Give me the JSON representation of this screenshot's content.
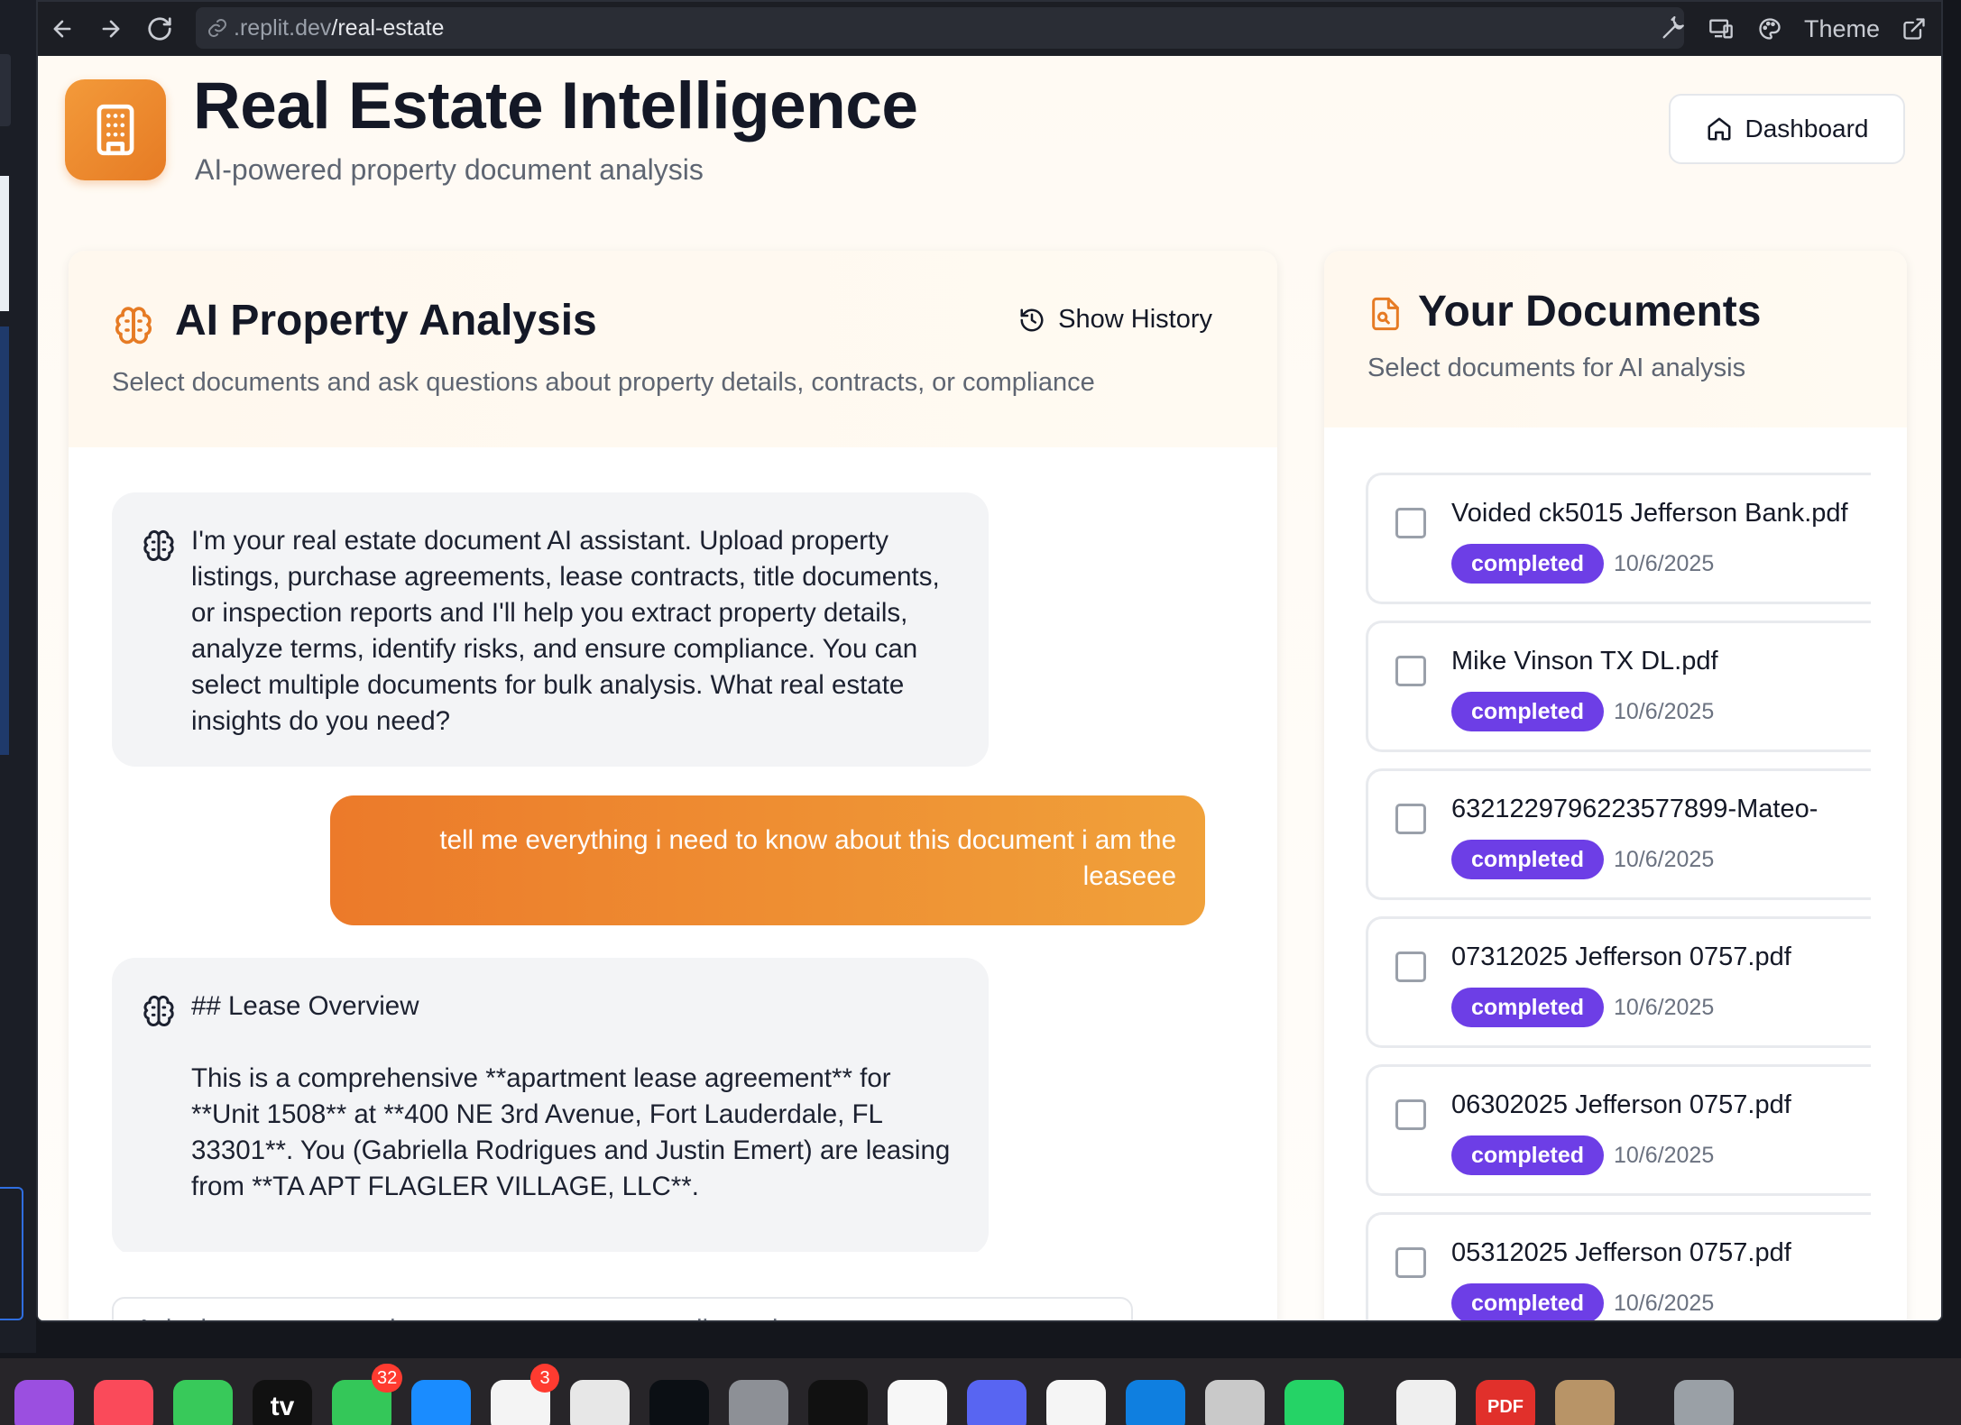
{
  "browser": {
    "url_domain": ".replit.dev",
    "url_path": "/real-estate",
    "theme_label": "Theme"
  },
  "header": {
    "title": "Real Estate Intelligence",
    "subtitle": "AI-powered property document analysis",
    "dashboard_label": "Dashboard"
  },
  "analysis": {
    "title": "AI Property Analysis",
    "history_label": "Show History",
    "description": "Select documents and ask questions about property details, contracts, or compliance",
    "messages": [
      {
        "role": "assistant",
        "text": "I'm your real estate document AI assistant. Upload property listings, purchase agreements, lease contracts, title documents, or inspection reports and I'll help you extract property details, analyze terms, identify risks, and ensure compliance. You can select multiple documents for bulk analysis. What real estate insights do you need?"
      },
      {
        "role": "user",
        "text": "tell me everything i need to know about this document i am the leaseee"
      },
      {
        "role": "assistant",
        "heading": "## Lease Overview",
        "text": "This is a comprehensive **apartment lease agreement** for **Unit 1508** at **400 NE 3rd Avenue, Fort Lauderdale, FL 33301**. You (Gabriella Rodrigues and Justin Emert) are leasing from **TA APT FLAGLER VILLAGE, LLC**."
      }
    ],
    "input_placeholder": "Ask about property values, contract terms, compliance issues..."
  },
  "documents": {
    "title": "Your Documents",
    "description": "Select documents for AI analysis",
    "items": [
      {
        "name": "Voided ck5015 Jefferson Bank.pdf",
        "status": "completed",
        "date": "10/6/2025"
      },
      {
        "name": "Mike Vinson TX DL.pdf",
        "status": "completed",
        "date": "10/6/2025"
      },
      {
        "name": "6321229796223577899-Mateo-",
        "status": "completed",
        "date": "10/6/2025"
      },
      {
        "name": "07312025 Jefferson 0757.pdf",
        "status": "completed",
        "date": "10/6/2025"
      },
      {
        "name": "06302025 Jefferson 0757.pdf",
        "status": "completed",
        "date": "10/6/2025"
      },
      {
        "name": "05312025 Jefferson 0757.pdf",
        "status": "completed",
        "date": "10/6/2025"
      }
    ]
  },
  "dock": {
    "messages_badge": "32",
    "photos_badge": "3",
    "tv_label": "tv",
    "pdf_label": "PDF"
  },
  "colors": {
    "accent_orange": "#ec7a2a",
    "badge_purple": "#6d3ee6"
  }
}
